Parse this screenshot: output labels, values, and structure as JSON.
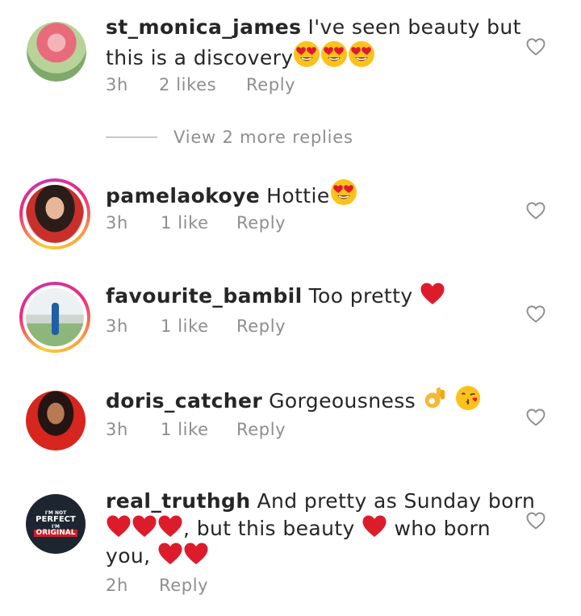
{
  "comments": [
    {
      "username": "st_monica_james",
      "text_line1": "I've seen beauty but",
      "text_line2": "this is a discovery",
      "time": "3h",
      "likes": "2 likes",
      "reply": "Reply"
    },
    {
      "username": "pamelaokoye",
      "text_line1": "Hottie",
      "time": "3h",
      "likes": "1 like",
      "reply": "Reply"
    },
    {
      "username": "favourite_bambil",
      "text_line1": "Too pretty",
      "time": "3h",
      "likes": "1 like",
      "reply": "Reply"
    },
    {
      "username": "doris_catcher",
      "text_line1": "Gorgeousness",
      "time": "3h",
      "likes": "1 like",
      "reply": "Reply"
    },
    {
      "username": "real_truthgh",
      "text_line1": "And pretty as Sunday born",
      "text_line2": ", but this beauty",
      "text_line2b": "who born",
      "text_line3": "you,",
      "time": "2h",
      "reply": "Reply"
    }
  ],
  "view_more_replies": "View 2 more replies",
  "avatar_badge": {
    "line1": "I'M NOT",
    "line2": "PERFECT",
    "line3": "I'M",
    "line4": "ORIGINAL"
  },
  "icons": {
    "heart": "heart-outline-icon",
    "heart_eyes": "heart-eyes-emoji",
    "red_heart": "red-heart-emoji",
    "ok_hand": "ok-hand-emoji",
    "kiss": "kissing-face-emoji"
  },
  "colors": {
    "text": "#262626",
    "meta": "#8e8e8e",
    "heart_emoji": "#e0192e",
    "emoji_yellow": "#fbc02d"
  }
}
